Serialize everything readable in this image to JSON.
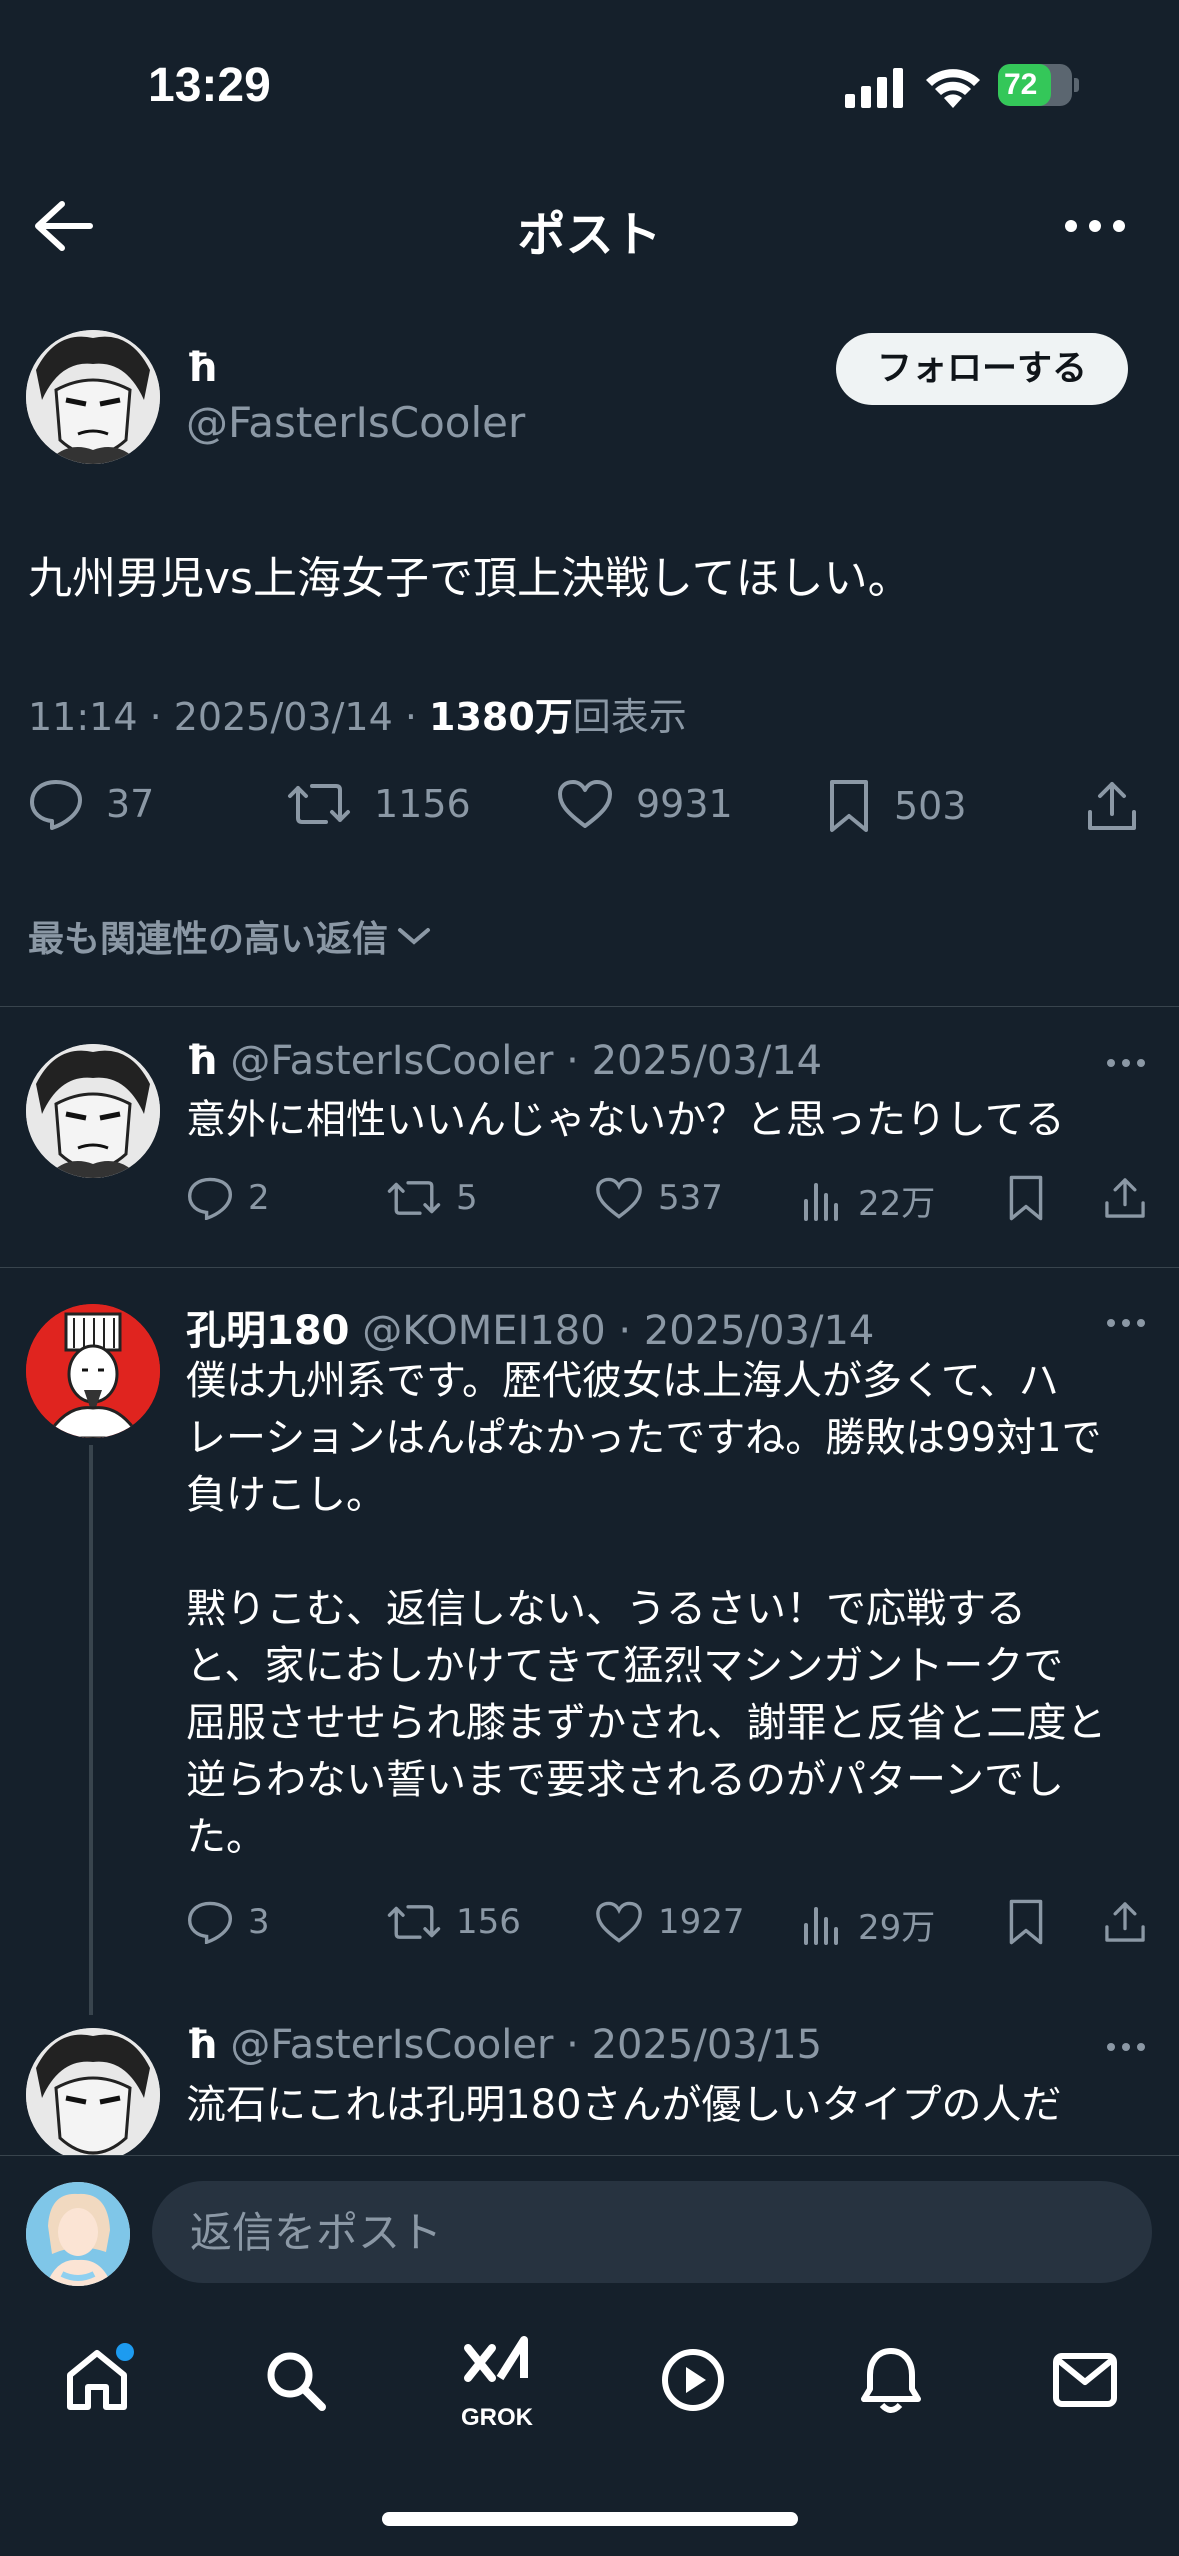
{
  "status_bar": {
    "time": "13:29",
    "battery": "72",
    "battery_level": 0.72
  },
  "header": {
    "title": "ポスト"
  },
  "main_post": {
    "author_name": "ħ",
    "handle": "@FasterIsCooler",
    "follow_label": "フォローする",
    "text": "九州男児vs上海女子で頂上決戦してほしい。",
    "time": "11:14 · 2025/03/14 · ",
    "views_count": "1380万",
    "views_suffix": "回表示",
    "replies": "37",
    "reposts": "1156",
    "likes": "9931",
    "bookmarks": "503"
  },
  "sort_label": "最も関連性の高い返信",
  "replies": [
    {
      "name": "ħ",
      "handle": "@FasterIsCooler",
      "date": "· 2025/03/14",
      "text": "意外に相性いいんじゃないか？と思ったりしてる",
      "replies": "2",
      "reposts": "5",
      "likes": "537",
      "views": "22万"
    },
    {
      "name": "孔明180",
      "handle": "@KOMEI180",
      "date": "· 2025/03/14",
      "text_lines": [
        "僕は九州系です。歴代彼女は上海人が多くて、ハ",
        "レーションはんぱなかったですね。勝敗は99対1で",
        "負けこし。",
        "",
        "黙りこむ、返信しない、うるさい！で応戦する",
        "と、家におしかけてきて猛烈マシンガントークで",
        "屈服させせられ膝まずかされ、謝罪と反省と二度と",
        "逆らわない誓いまで要求されるのがパターンでし",
        "た。"
      ],
      "replies": "3",
      "reposts": "156",
      "likes": "1927",
      "views": "29万"
    },
    {
      "name": "ħ",
      "handle": "@FasterIsCooler",
      "date": "· 2025/03/15",
      "text": "流石にこれは孔明180さんが優しいタイプの人だ"
    }
  ],
  "reply_bar": {
    "placeholder": "返信をポスト"
  },
  "tab_bar": {
    "grok_label": "GROK"
  }
}
